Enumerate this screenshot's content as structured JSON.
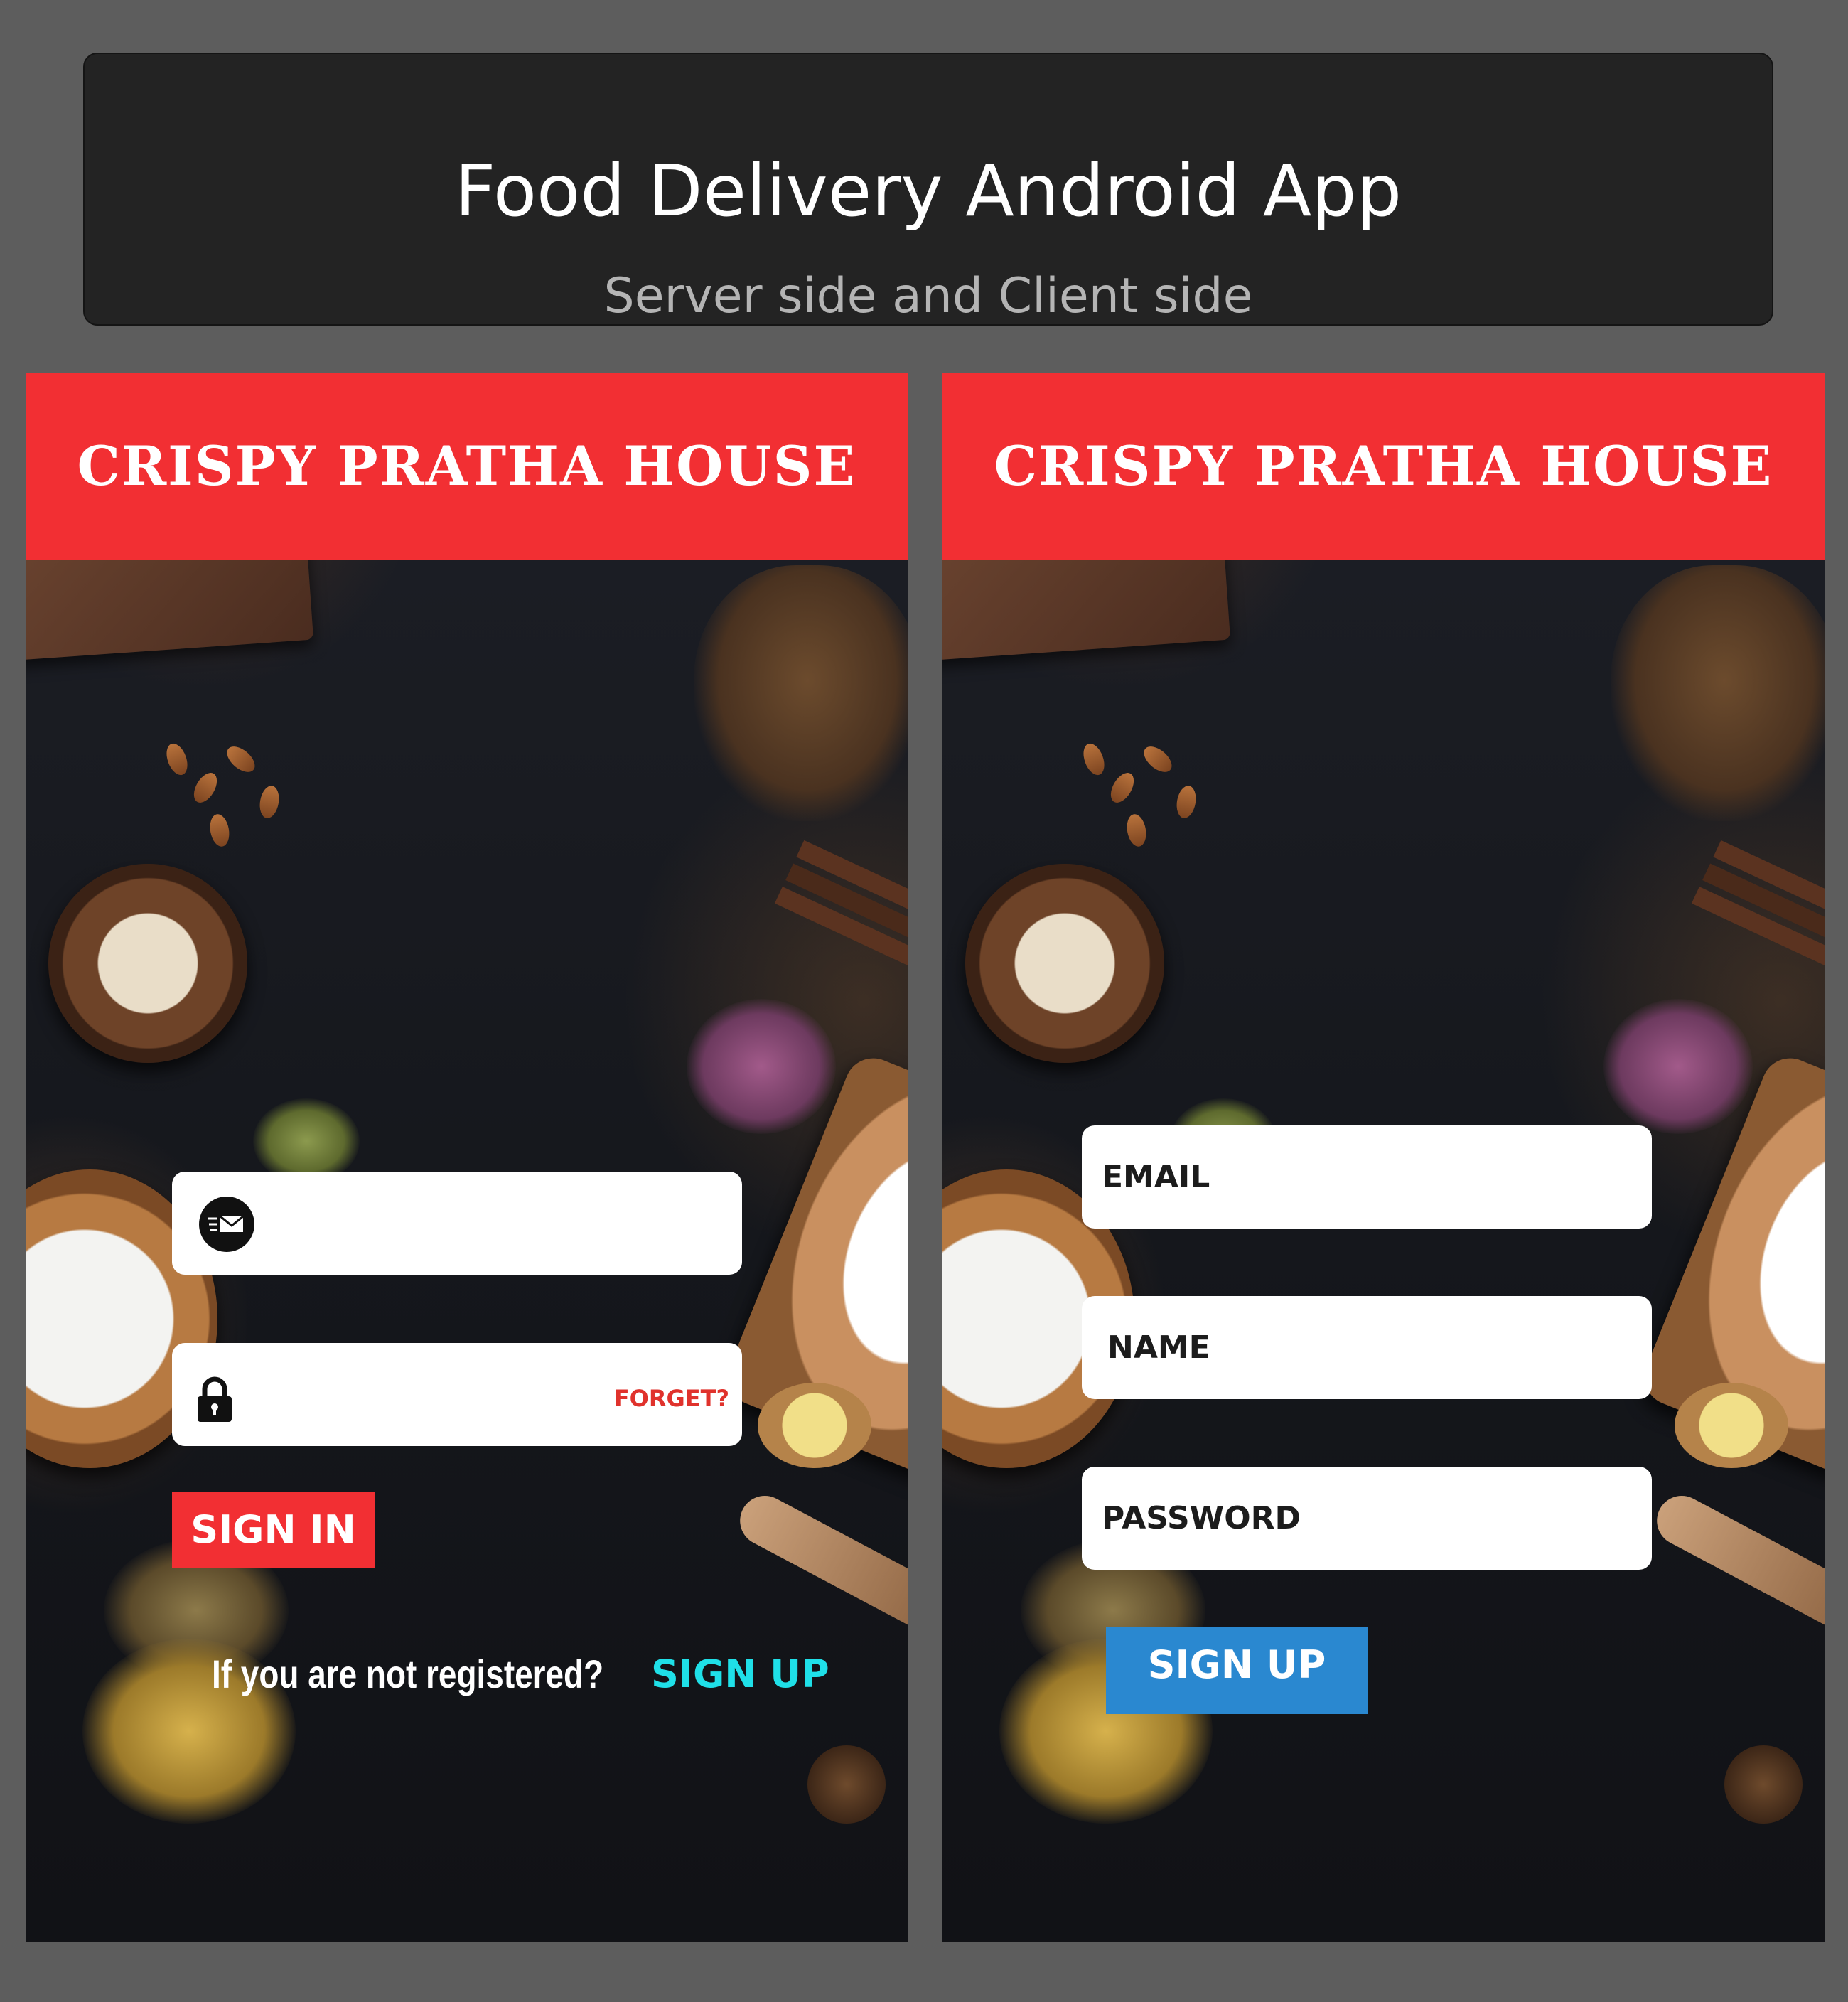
{
  "banner": {
    "title": "Food Delivery Android App",
    "subtitle": "Server side and Client side"
  },
  "app_name": "CRISPY PRATHA HOUSE",
  "sign_in_screen": {
    "header": "CRISPY PRATHA HOUSE",
    "email_icon": "email-icon",
    "password_icon": "lock-icon",
    "forget_label": "FORGET?",
    "sign_in_label": "SIGN IN",
    "register_prompt": "If you are not registered?",
    "sign_up_link": "SIGN UP"
  },
  "sign_up_screen": {
    "header": "CRISPY PRATHA HOUSE",
    "email_placeholder": "EMAIL",
    "name_placeholder": "NAME",
    "password_placeholder": "PASSWORD",
    "sign_up_label": "SIGN UP"
  },
  "colors": {
    "page_background": "#5d5d5d",
    "banner_background": "#232323",
    "header_red": "#f22f33",
    "sign_up_link_cyan": "#1fe0e8",
    "sign_up_button_blue": "#2a88d0",
    "forget_red": "#e0322c"
  }
}
